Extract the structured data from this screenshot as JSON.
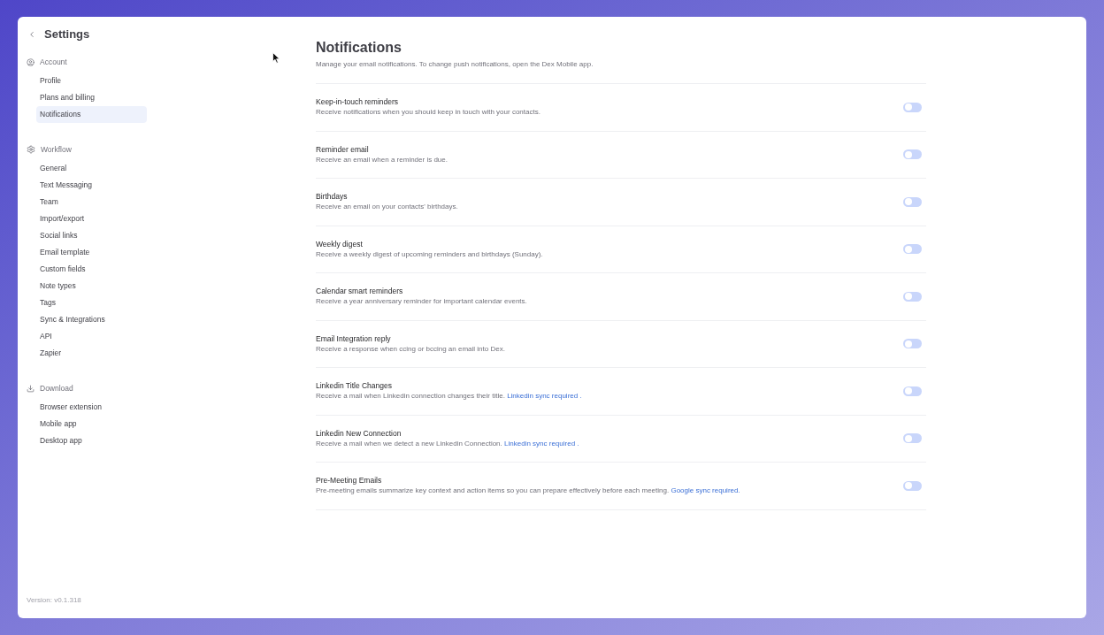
{
  "sidebar": {
    "title": "Settings",
    "sections": [
      {
        "kind": "account",
        "label": "Account",
        "items": [
          {
            "label": "Profile",
            "selected": false
          },
          {
            "label": "Plans and billing",
            "selected": false
          },
          {
            "label": "Notifications",
            "selected": true
          }
        ]
      },
      {
        "kind": "workflow",
        "label": "Workflow",
        "items": [
          {
            "label": "General",
            "selected": false
          },
          {
            "label": "Text Messaging",
            "selected": false
          },
          {
            "label": "Team",
            "selected": false
          },
          {
            "label": "Import/export",
            "selected": false
          },
          {
            "label": "Social links",
            "selected": false
          },
          {
            "label": "Email template",
            "selected": false
          },
          {
            "label": "Custom fields",
            "selected": false
          },
          {
            "label": "Note types",
            "selected": false
          },
          {
            "label": "Tags",
            "selected": false
          },
          {
            "label": "Sync & Integrations",
            "selected": false
          },
          {
            "label": "API",
            "selected": false
          },
          {
            "label": "Zapier",
            "selected": false
          }
        ]
      },
      {
        "kind": "download",
        "label": "Download",
        "items": [
          {
            "label": "Browser extension",
            "selected": false
          },
          {
            "label": "Mobile app",
            "selected": false
          },
          {
            "label": "Desktop app",
            "selected": false
          }
        ]
      }
    ],
    "version": "Version: v0.1.318"
  },
  "main": {
    "title": "Notifications",
    "description": "Manage your email notifications. To change push notifications, open the Dex Mobile app.",
    "settings": [
      {
        "title": "Keep-in-touch reminders",
        "description": "Receive notifications when you should keep in touch with your contacts.",
        "on": false
      },
      {
        "title": "Reminder email",
        "description": "Receive an email when a reminder is due.",
        "on": false
      },
      {
        "title": "Birthdays",
        "description": "Receive an email on your contacts' birthdays.",
        "on": false
      },
      {
        "title": "Weekly digest",
        "description": "Receive a weekly digest of upcoming reminders and birthdays (Sunday).",
        "on": false
      },
      {
        "title": "Calendar smart reminders",
        "description": "Receive a year anniversary reminder for important calendar events.",
        "on": false
      },
      {
        "title": "Email Integration reply",
        "description": "Receive a response when ccing or bccing an email into Dex.",
        "on": false
      },
      {
        "title": "Linkedin Title Changes",
        "description": "Receive a mail when Linkedin connection changes their title.",
        "link": "Linkedin sync required .",
        "on": false
      },
      {
        "title": "Linkedin New Connection",
        "description": "Receive a mail when we detect a new Linkedin Connection.",
        "link": "Linkedin sync required .",
        "on": false
      },
      {
        "title": "Pre-Meeting Emails",
        "description": "Pre-meeting emails summarize key context and action items so you can prepare effectively before each meeting.",
        "link": "Google sync required.",
        "on": false
      }
    ]
  }
}
